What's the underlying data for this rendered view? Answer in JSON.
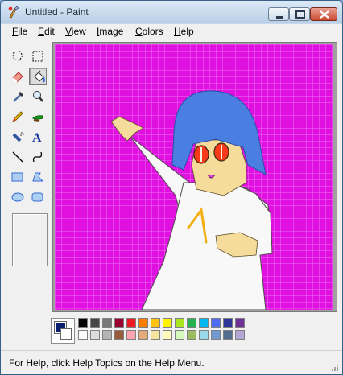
{
  "window": {
    "title": "Untitled - Paint"
  },
  "menu": [
    {
      "mnemonic": "F",
      "rest": "ile"
    },
    {
      "mnemonic": "E",
      "rest": "dit"
    },
    {
      "mnemonic": "V",
      "rest": "iew"
    },
    {
      "mnemonic": "I",
      "rest": "mage"
    },
    {
      "mnemonic": "C",
      "rest": "olors"
    },
    {
      "mnemonic": "H",
      "rest": "elp"
    }
  ],
  "tools": [
    "free-form-select",
    "select",
    "eraser",
    "fill-with-color",
    "pick-color",
    "magnifier",
    "pencil",
    "brush",
    "airbrush",
    "text",
    "line",
    "curve",
    "rectangle",
    "polygon",
    "ellipse",
    "rounded-rectangle"
  ],
  "selected_tool": "fill-with-color",
  "palette": {
    "foreground": "#0a1f6e",
    "background": "#ffffff",
    "row1": [
      "#000000",
      "#464646",
      "#787878",
      "#990030",
      "#ed1c24",
      "#ff7e00",
      "#ffc20e",
      "#fff200",
      "#a8e61d",
      "#22b14c",
      "#00b7ef",
      "#4d6df3",
      "#2f3699",
      "#6f3198"
    ],
    "row2": [
      "#ffffff",
      "#dcdcdc",
      "#b4b4b4",
      "#9c5a3c",
      "#ffa3b1",
      "#e5aa7a",
      "#f5e49c",
      "#fff9bd",
      "#d3f9bc",
      "#9dbb61",
      "#99d9ea",
      "#709ad1",
      "#546d8e",
      "#b5a5d5"
    ]
  },
  "canvas": {
    "background": "#e010e0",
    "grid": "#f070f0"
  },
  "status": {
    "text": "For Help, click Help Topics on the Help Menu."
  }
}
